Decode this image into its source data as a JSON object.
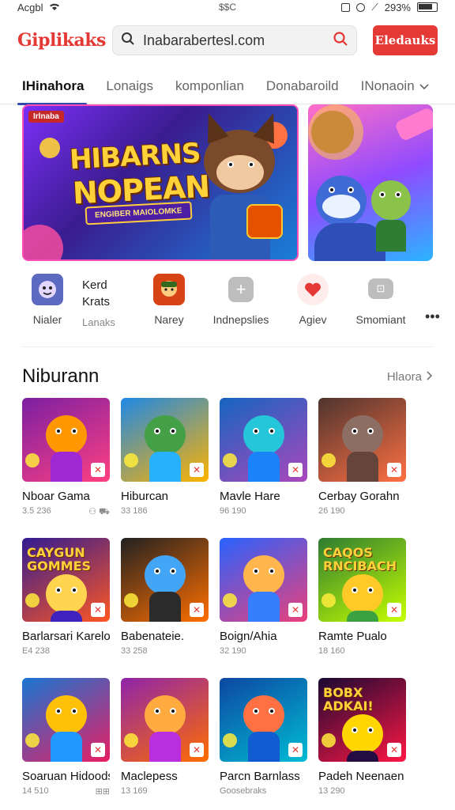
{
  "status": {
    "carrier": "Acgbl",
    "center": "$$C",
    "battery": "293%"
  },
  "header": {
    "logo": "Giplikaks",
    "search_value": "Inabarabertesl.com",
    "cta_label": "Eledauks"
  },
  "tabs": [
    {
      "label": "IHinahora"
    },
    {
      "label": "Lonaigs"
    },
    {
      "label": "komponlian"
    },
    {
      "label": "Donabaroild"
    },
    {
      "label": "INonaoin"
    }
  ],
  "hero": {
    "badge": "Irlnaba",
    "title_line1": "HIBARNS",
    "title_line2": "NOPEAN",
    "ribbon": "ENGIBER MAIOLOMKE"
  },
  "quick": [
    {
      "label": "Nialer",
      "icon": "avatar-icon",
      "color": "#5c6bc0"
    },
    {
      "title": "Kerd",
      "subtitle": "Krats",
      "label": "Lanaks"
    },
    {
      "label": "Narey",
      "icon": "game-icon",
      "color": "#d84315"
    },
    {
      "label": "Indnepslies",
      "icon": "plus-icon",
      "color": "#9e9e9e"
    },
    {
      "label": "Agiev",
      "icon": "heart-icon",
      "color": "#e53935"
    },
    {
      "label": "Smomiant",
      "icon": "gamepad-icon",
      "color": "#9e9e9e"
    }
  ],
  "quick_more": "•••",
  "section": {
    "title": "Niburann",
    "more": "Hlaora"
  },
  "games": [
    {
      "name": "Nboar Gama",
      "meta": "3.5 236",
      "extra": "⚇ ⛟"
    },
    {
      "name": "Hiburcan",
      "meta": "33 186",
      "extra": ""
    },
    {
      "name": "Mavle Hare",
      "meta": "96 190",
      "extra": ""
    },
    {
      "name": "Cerbay Gorahn",
      "meta": "26 190",
      "extra": ""
    },
    {
      "name": "Barlarsari Karelo",
      "meta": "E4 238",
      "extra": "",
      "caption": "CAYGUN GOMMES"
    },
    {
      "name": "Babenateie.",
      "meta": "33 258",
      "extra": ""
    },
    {
      "name": "Boign/Ahia",
      "meta": "32 190",
      "extra": ""
    },
    {
      "name": "Ramte Pualo",
      "meta": "18 160",
      "extra": "",
      "caption": "CAQOS RNCIBACH"
    },
    {
      "name": "Soaruan Hidoodsil",
      "meta": "14 510",
      "extra": "⊞⊞"
    },
    {
      "name": "Maclepess",
      "meta": "13 169",
      "extra": ""
    },
    {
      "name": "Parcn Barnlass",
      "meta": "Goosebraks",
      "extra": ""
    },
    {
      "name": "Padeh Neenaen",
      "meta": "13 290",
      "extra": "",
      "caption": "BOBX ADKAI!"
    }
  ],
  "colors": {
    "brand": "#e53935",
    "tab_indicator": "#2f4aa8"
  }
}
